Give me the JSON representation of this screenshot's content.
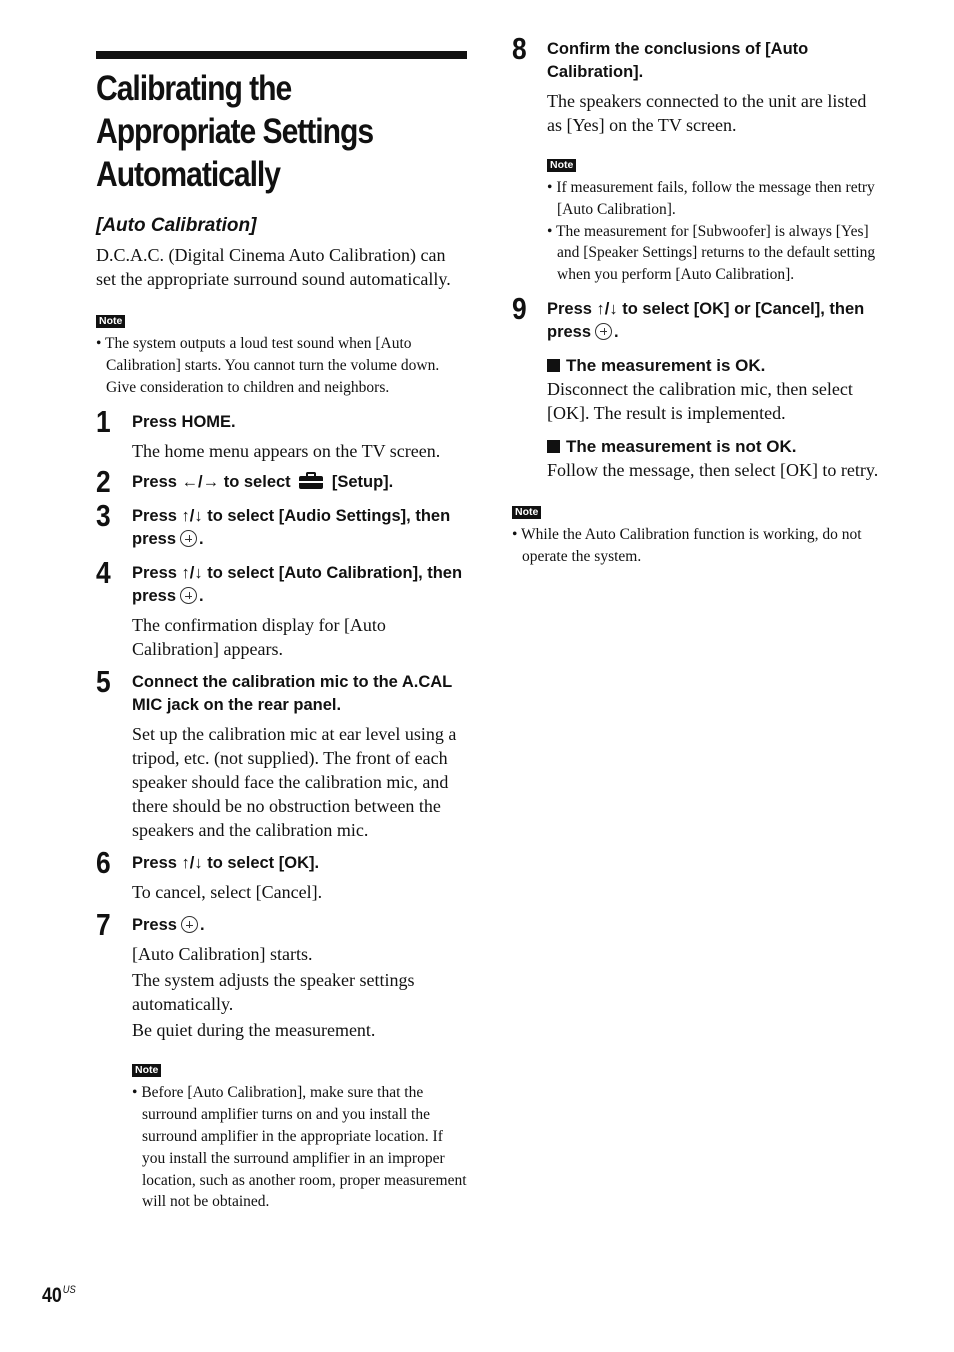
{
  "page": {
    "title": "Calibrating the Appropriate Settings Automatically",
    "title_lines": [
      "Calibrating the",
      "Appropriate Settings",
      "Automatically"
    ],
    "subtitle": "[Auto Calibration]",
    "intro": "D.C.A.C. (Digital Cinema Auto Calibration) can set the appropriate surround sound automatically.",
    "note_label": "Note",
    "page_number": "40",
    "page_region": "US"
  },
  "intro_note": {
    "items": [
      "The system outputs a loud test sound when [Auto Calibration] starts. You cannot turn the volume down. Give consideration to children and neighbors."
    ]
  },
  "icons": {
    "enter": "enter-button-icon",
    "setup": "toolbox-setup-icon",
    "left_right": "←/→",
    "up_down": "↑/↓"
  },
  "steps": [
    {
      "number": "1",
      "heading": "Press HOME.",
      "body": [
        "The home menu appears on the TV screen."
      ]
    },
    {
      "number": "2",
      "heading_pre": "Press ",
      "heading_arrows": "←/→",
      "heading_mid": " to select ",
      "heading_post": " [Setup].",
      "body": []
    },
    {
      "number": "3",
      "heading_pre": "Press ",
      "heading_arrows": "↑/↓",
      "heading_mid": " to select [Audio Settings], then press",
      "heading_post": ".",
      "body": []
    },
    {
      "number": "4",
      "heading_pre": "Press ",
      "heading_arrows": "↑/↓",
      "heading_mid": " to select [Auto Calibration], then press",
      "heading_post": ".",
      "body": [
        "The confirmation display for [Auto Calibration] appears."
      ]
    },
    {
      "number": "5",
      "heading": "Connect the calibration mic to the A.CAL MIC jack on the rear panel.",
      "body": [
        "Set up the calibration mic at ear level using a tripod, etc. (not supplied). The front of each speaker should face the calibration mic, and there should be no obstruction between the speakers and the calibration mic."
      ]
    },
    {
      "number": "6",
      "heading_pre": "Press ",
      "heading_arrows": "↑/↓",
      "heading_mid": " to select [OK].",
      "body": [
        "To cancel, select [Cancel]."
      ]
    },
    {
      "number": "7",
      "heading_pre": "Press",
      "heading_post": ".",
      "body": [
        "[Auto Calibration] starts.",
        "The system adjusts the speaker settings automatically.",
        "Be quiet during the measurement."
      ],
      "note": [
        "Before [Auto Calibration], make sure that the surround amplifier turns on and you install the surround amplifier in the appropriate location. If you install the surround amplifier in an improper location, such as another room, proper measurement will not be obtained."
      ]
    },
    {
      "number": "8",
      "heading": "Confirm the conclusions of [Auto Calibration].",
      "body": [
        "The speakers connected to the unit are listed as [Yes] on the TV screen."
      ],
      "note": [
        "If measurement fails, follow the message then retry [Auto Calibration].",
        "The measurement for [Subwoofer] is always [Yes] and [Speaker Settings] returns to the default setting when you perform [Auto Calibration]."
      ]
    },
    {
      "number": "9",
      "heading_pre": "Press ",
      "heading_arrows": "↑/↓",
      "heading_mid": " to select [OK] or [Cancel], then press",
      "heading_post": ".",
      "results": [
        {
          "heading": "The measurement is OK.",
          "body": "Disconnect the calibration mic, then select [OK]. The result is implemented."
        },
        {
          "heading": "The measurement is not OK.",
          "body": "Follow the message, then select [OK] to retry."
        }
      ]
    }
  ],
  "final_note": {
    "items": [
      "While the Auto Calibration function is working, do not operate the system."
    ]
  }
}
